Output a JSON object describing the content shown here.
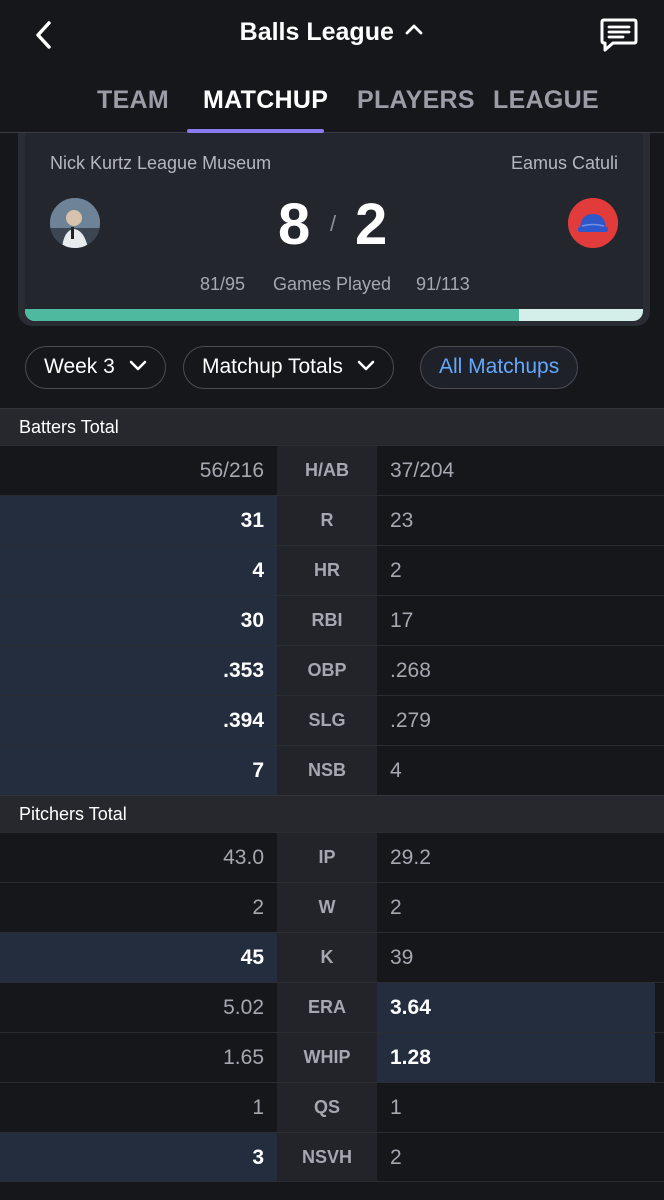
{
  "header": {
    "title": "Balls League",
    "back_icon": "chevron-left-icon",
    "title_caret_icon": "chevron-up-icon",
    "chat_icon": "chat-bubble-icon"
  },
  "tabs": [
    {
      "label": "TEAM",
      "active": false
    },
    {
      "label": "MATCHUP",
      "active": true
    },
    {
      "label": "PLAYERS",
      "active": false
    },
    {
      "label": "LEAGUE",
      "active": false
    }
  ],
  "matchup": {
    "left_team": "Nick Kurtz League Museum",
    "right_team": "Eamus Catuli",
    "left_score": "8",
    "right_score": "2",
    "score_separator": "/",
    "left_games": "81/95",
    "games_label": "Games Played",
    "right_games": "91/113",
    "progress_fraction": 0.8,
    "colors": {
      "progress": "#4fb9a0",
      "progress_track": "#d4efe9",
      "accent": "#8a7cf0"
    }
  },
  "filters": {
    "week": "Week 3",
    "totals": "Matchup Totals",
    "all_matchups": "All Matchups"
  },
  "batters": {
    "title": "Batters Total",
    "rows": [
      {
        "left": "56/216",
        "stat": "H/AB",
        "right": "37/204",
        "winner": ""
      },
      {
        "left": "31",
        "stat": "R",
        "right": "23",
        "winner": "left"
      },
      {
        "left": "4",
        "stat": "HR",
        "right": "2",
        "winner": "left"
      },
      {
        "left": "30",
        "stat": "RBI",
        "right": "17",
        "winner": "left"
      },
      {
        "left": ".353",
        "stat": "OBP",
        "right": ".268",
        "winner": "left"
      },
      {
        "left": ".394",
        "stat": "SLG",
        "right": ".279",
        "winner": "left"
      },
      {
        "left": "7",
        "stat": "NSB",
        "right": "4",
        "winner": "left"
      }
    ]
  },
  "pitchers": {
    "title": "Pitchers Total",
    "rows": [
      {
        "left": "43.0",
        "stat": "IP",
        "right": "29.2",
        "winner": ""
      },
      {
        "left": "2",
        "stat": "W",
        "right": "2",
        "winner": ""
      },
      {
        "left": "45",
        "stat": "K",
        "right": "39",
        "winner": "left"
      },
      {
        "left": "5.02",
        "stat": "ERA",
        "right": "3.64",
        "winner": "right"
      },
      {
        "left": "1.65",
        "stat": "WHIP",
        "right": "1.28",
        "winner": "right"
      },
      {
        "left": "1",
        "stat": "QS",
        "right": "1",
        "winner": ""
      },
      {
        "left": "3",
        "stat": "NSVH",
        "right": "2",
        "winner": "left"
      }
    ]
  }
}
